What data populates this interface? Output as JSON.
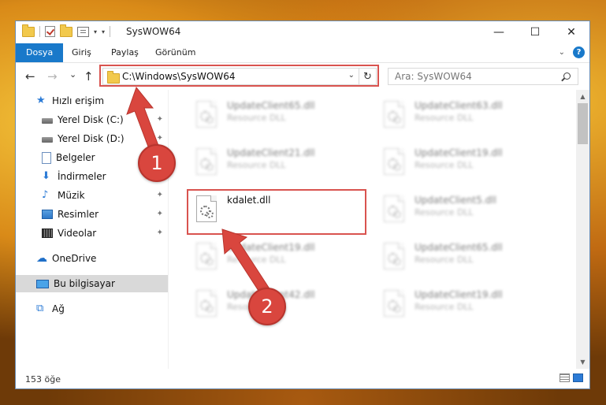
{
  "window": {
    "title": "SysWOW64",
    "buttons": {
      "minimize": "—",
      "maximize": "☐",
      "close": "✕"
    }
  },
  "ribbon": {
    "tabs": [
      "Dosya",
      "Giriş",
      "Paylaş",
      "Görünüm"
    ],
    "active_tab": "Dosya",
    "accent": "#1979ca"
  },
  "nav": {
    "back": "←",
    "forward": "→",
    "recent": "⌄",
    "up": "↑",
    "address": "C:\\Windows\\SysWOW64",
    "refresh": "↻",
    "search_placeholder": "Ara: SysWOW64"
  },
  "sidebar": {
    "items": [
      {
        "label": "Hızlı erişim",
        "icon": "star-icon",
        "pinned": false
      },
      {
        "label": "Yerel Disk (C:)",
        "icon": "disk-icon",
        "pinned": true
      },
      {
        "label": "Yerel Disk (D:)",
        "icon": "disk-icon",
        "pinned": true
      },
      {
        "label": "Belgeler",
        "icon": "document-icon",
        "pinned": true
      },
      {
        "label": "İndirmeler",
        "icon": "download-icon",
        "pinned": true
      },
      {
        "label": "Müzik",
        "icon": "music-icon",
        "pinned": true
      },
      {
        "label": "Resimler",
        "icon": "pictures-icon",
        "pinned": true
      },
      {
        "label": "Videolar",
        "icon": "videos-icon",
        "pinned": true
      },
      {
        "label": "OneDrive",
        "icon": "onedrive-icon",
        "pinned": false
      },
      {
        "label": "Bu bilgisayar",
        "icon": "computer-icon",
        "pinned": false,
        "selected": true
      },
      {
        "label": "Ağ",
        "icon": "network-icon",
        "pinned": false
      }
    ],
    "pin_glyph": "📌"
  },
  "files": {
    "left_column": [
      {
        "name": "UpdateClient65.dll",
        "type": "Resource DLL",
        "blurred": true
      },
      {
        "name": "UpdateClient21.dll",
        "type": "Resource DLL",
        "blurred": true
      },
      {
        "name": "kdalet.dll",
        "type": "",
        "blurred": false,
        "highlighted": true
      },
      {
        "name": "UpdateClient19.dll",
        "type": "Resource DLL",
        "blurred": true
      },
      {
        "name": "UpdateClient42.dll",
        "type": "Resource DLL",
        "blurred": true
      }
    ],
    "right_column": [
      {
        "name": "UpdateClient63.dll",
        "type": "Resource DLL",
        "blurred": true
      },
      {
        "name": "UpdateClient19.dll",
        "type": "Resource DLL",
        "blurred": true
      },
      {
        "name": "UpdateClient5.dll",
        "type": "Resource DLL",
        "blurred": true
      },
      {
        "name": "UpdateClient65.dll",
        "type": "Resource DLL",
        "blurred": true
      },
      {
        "name": "UpdateClient19.dll",
        "type": "Resource DLL",
        "blurred": true
      }
    ]
  },
  "status": {
    "count": "153 öğe"
  },
  "annotations": {
    "step1": "1",
    "step2": "2",
    "color": "#d9463e"
  }
}
